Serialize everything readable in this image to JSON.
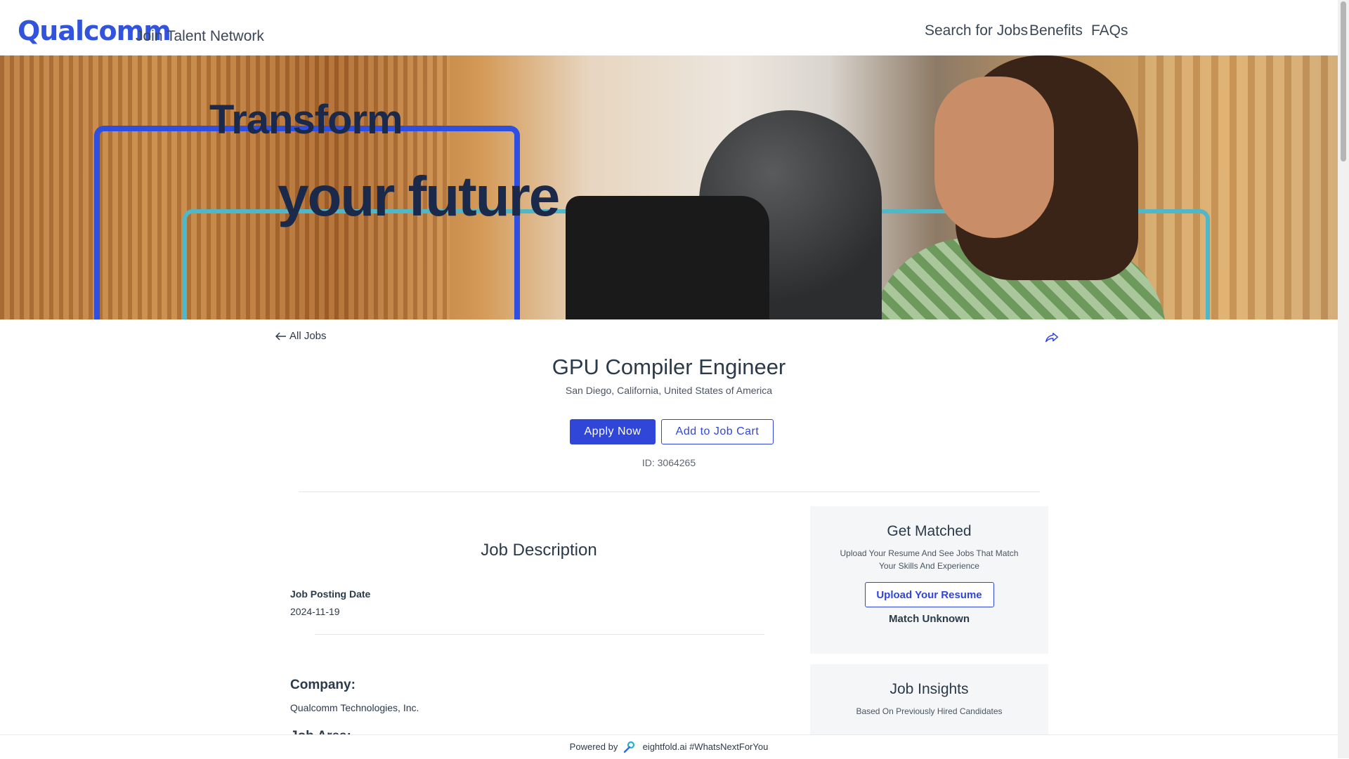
{
  "header": {
    "logo": "Qualcomm",
    "tagline": "Join Talent Network",
    "nav": {
      "search": "Search for Jobs",
      "benefits": "Benefits",
      "faqs": "FAQs"
    }
  },
  "hero": {
    "line1": "Transform",
    "line2": "your future"
  },
  "job": {
    "back_label": "All Jobs",
    "title": "GPU Compiler Engineer",
    "location": "San Diego, California, United States of America",
    "apply_label": "Apply Now",
    "cart_label": "Add to Job Cart",
    "id": "ID: 3064265"
  },
  "description": {
    "section_title": "Job Description",
    "posting_date_label": "Job Posting Date",
    "posting_date": "2024-11-19",
    "company_heading": "Company:",
    "company_value": "Qualcomm Technologies, Inc.",
    "next_heading": "Job Area:"
  },
  "get_matched": {
    "title": "Get Matched",
    "subtitle": "Upload Your Resume And See Jobs That Match Your Skills And Experience",
    "button": "Upload Your Resume",
    "status": "Match Unknown"
  },
  "job_insights": {
    "title": "Job Insights",
    "subtitle": "Based On Previously Hired Candidates"
  },
  "footer": {
    "powered_by": "Powered by",
    "brand": "eightfold.ai #WhatsNextForYou"
  },
  "colors": {
    "brand_blue": "#3253dc",
    "primary_button": "#3046d8",
    "text": "#2b3a4a"
  }
}
